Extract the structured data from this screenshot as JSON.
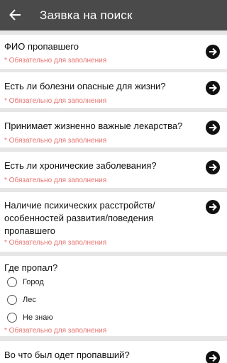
{
  "appbar": {
    "title": "Заявка на поиск",
    "back_icon": "arrow-back-icon"
  },
  "required_hint": "* Обязательно для заполнения",
  "questions": [
    {
      "label": "ФИО пропавшего",
      "hint": "* Обязательно для заполнения"
    },
    {
      "label": "Есть ли болезни опасные для жизни?",
      "hint": "* Обязательно для заполнения"
    },
    {
      "label": "Принимает жизненно важные лекарства?",
      "hint": "* Обязательно для заполнения"
    },
    {
      "label": "Есть ли хронические заболевания?",
      "hint": "* Обязательно для заполнения"
    },
    {
      "label": "Наличие психических расстройств/ особенностей развития/поведения пропавшего",
      "hint": "* Обязательно для заполнения"
    },
    {
      "label": "Где пропал?",
      "hint": "* Обязательно для заполнения",
      "options": [
        "Город",
        "Лес",
        "Не знаю"
      ]
    },
    {
      "label": "Во что был одет пропавший?",
      "hint": ""
    }
  ],
  "colors": {
    "appbar": "#4a4a4a",
    "background": "#e6e6e6",
    "hint": "#e8736f",
    "arrow": "#111111"
  }
}
